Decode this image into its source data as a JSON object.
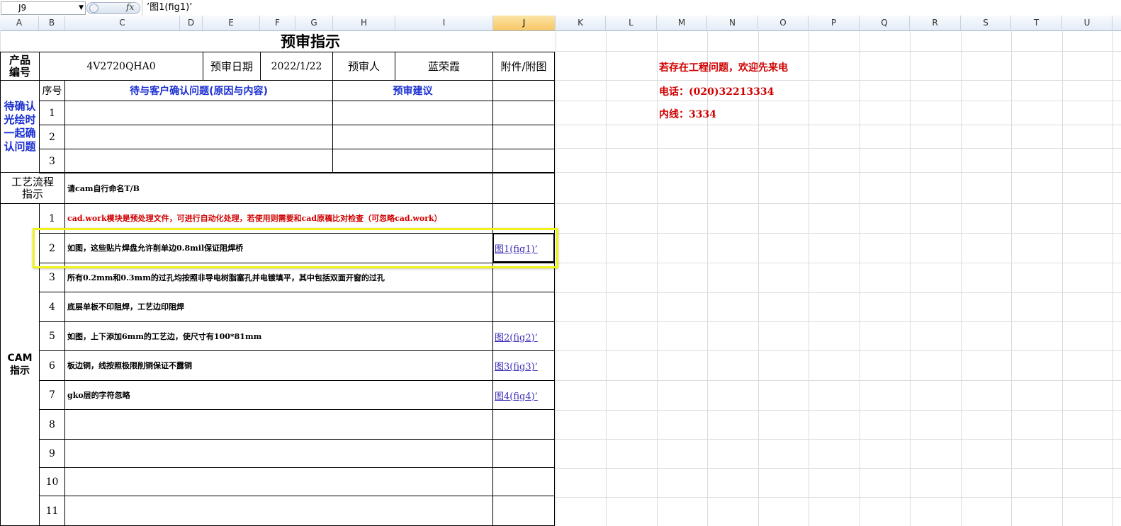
{
  "formula_bar": {
    "name_box": "J9",
    "fx_label": "fx",
    "formula": "’图1(fig1)’"
  },
  "columns": [
    "A",
    "B",
    "C",
    "D",
    "E",
    "F",
    "G",
    "H",
    "I",
    "J",
    "K",
    "L",
    "M",
    "N",
    "O",
    "P",
    "Q",
    "R",
    "S",
    "T",
    "U"
  ],
  "selected_column": "J",
  "sheet": {
    "title": "预审指示",
    "header": {
      "product_label": "产品\n编号",
      "product_value": "4V2720QHA0",
      "date_label": "预审日期",
      "date_value": "2022/1/22",
      "reviewer_label": "预审人",
      "reviewer_value": "蓝荣霞",
      "attach_label": "附件/附图"
    },
    "confirm_section": {
      "side_label": "待确认\n光绘时\n一起确\n认问题",
      "seq_label": "序号",
      "issue_header": "待与客户确认问题(原因与内容)",
      "suggest_header": "预审建议",
      "rows": [
        "1",
        "2",
        "3"
      ]
    },
    "process": {
      "label": "工艺流程\n指示",
      "text": "请cam自行命名T/B"
    },
    "cam": {
      "label": "CAM\n指示",
      "rows": [
        {
          "no": "1",
          "text": "cad.work模块是预处理文件，可进行自动化处理，若使用则需要和cad原稿比对检查（可忽略cad.work）",
          "attach": ""
        },
        {
          "no": "2",
          "text": "如图，这些贴片焊盘允许削单边0.8mil保证阻焊桥",
          "attach": "图1(fig1)’"
        },
        {
          "no": "3",
          "text": "所有0.2mm和0.3mm的过孔均按照非导电树脂塞孔并电镀填平，其中包括双面开窗的过孔",
          "attach": ""
        },
        {
          "no": "4",
          "text": "底层单板不印阻焊，工艺边印阻焊",
          "attach": ""
        },
        {
          "no": "5",
          "text": "如图，上下添加6mm的工艺边，使尺寸有100*81mm",
          "attach": "图2(fig2)’"
        },
        {
          "no": "6",
          "text": "板边铜，线按照极限削铜保证不露铜",
          "attach": "图3(fig3)’"
        },
        {
          "no": "7",
          "text": "gko层的字符忽略",
          "attach": "图4(fig4)’"
        },
        {
          "no": "8",
          "text": "",
          "attach": ""
        },
        {
          "no": "9",
          "text": "",
          "attach": ""
        },
        {
          "no": "10",
          "text": "",
          "attach": ""
        },
        {
          "no": "11",
          "text": "",
          "attach": ""
        }
      ]
    },
    "notes": [
      "若存在工程问题，欢迎先来电",
      "电话：(020)32213334",
      "内线：3334"
    ]
  },
  "colors": {
    "red": "#d00000",
    "blue": "#1a2fd1",
    "highlight": "#f2f21c",
    "selected_header": "#f7c766"
  }
}
